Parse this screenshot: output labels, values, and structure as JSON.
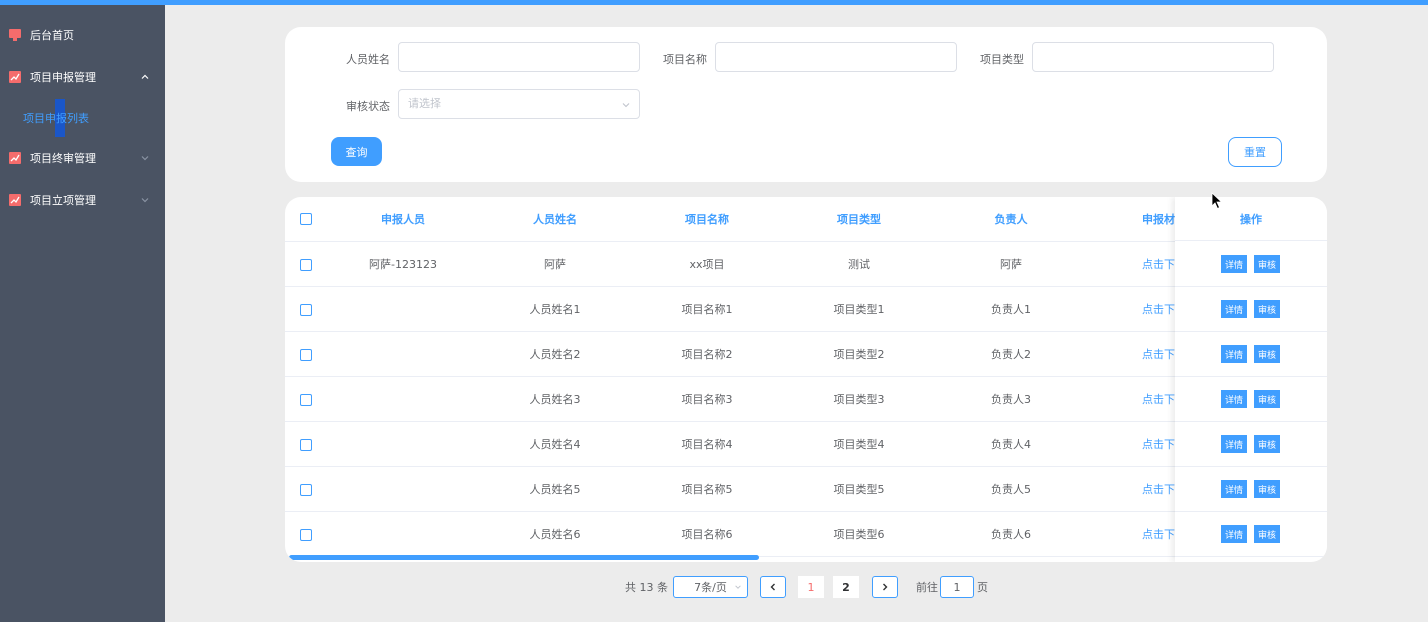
{
  "sidebar": {
    "items": [
      {
        "label": "后台首页"
      },
      {
        "label": "项目申报管理",
        "expanded": true
      },
      {
        "label": "项目终审管理"
      },
      {
        "label": "项目立项管理"
      }
    ],
    "submenu": {
      "label": "项目申报列表",
      "active": true
    },
    "icon_color": "#f56c6c"
  },
  "search": {
    "name_label": "人员姓名",
    "name_value": "",
    "project_label": "项目名称",
    "project_value": "",
    "type_label": "项目类型",
    "type_value": "",
    "status_label": "审核状态",
    "status_placeholder": "请选择",
    "query_button": "查询",
    "reset_button": "重置"
  },
  "table": {
    "columns": [
      "申报人员",
      "人员姓名",
      "项目名称",
      "项目类型",
      "负责人",
      "申报材",
      "操作"
    ],
    "rows": [
      {
        "applicant": "阿萨-123123",
        "name": "阿萨",
        "project": "xx项目",
        "type": "测试",
        "owner": "阿萨",
        "material": "点击下"
      },
      {
        "applicant": "",
        "name": "人员姓名1",
        "project": "项目名称1",
        "type": "项目类型1",
        "owner": "负责人1",
        "material": "点击下"
      },
      {
        "applicant": "",
        "name": "人员姓名2",
        "project": "项目名称2",
        "type": "项目类型2",
        "owner": "负责人2",
        "material": "点击下"
      },
      {
        "applicant": "",
        "name": "人员姓名3",
        "project": "项目名称3",
        "type": "项目类型3",
        "owner": "负责人3",
        "material": "点击下"
      },
      {
        "applicant": "",
        "name": "人员姓名4",
        "project": "项目名称4",
        "type": "项目类型4",
        "owner": "负责人4",
        "material": "点击下"
      },
      {
        "applicant": "",
        "name": "人员姓名5",
        "project": "项目名称5",
        "type": "项目类型5",
        "owner": "负责人5",
        "material": "点击下"
      },
      {
        "applicant": "",
        "name": "人员姓名6",
        "project": "项目名称6",
        "type": "项目类型6",
        "owner": "负责人6",
        "material": "点击下"
      }
    ],
    "detail_label": "详情",
    "review_label": "审核"
  },
  "pagination": {
    "total": "共 13 条",
    "page_size": "7条/页",
    "pages": [
      "1",
      "2"
    ],
    "current_page": "1",
    "goto_prefix": "前往",
    "goto_value": "1",
    "goto_suffix": "页"
  },
  "colors": {
    "primary": "#409eff",
    "sidebar": "#4a5363",
    "active_page": "#f56c6c"
  }
}
